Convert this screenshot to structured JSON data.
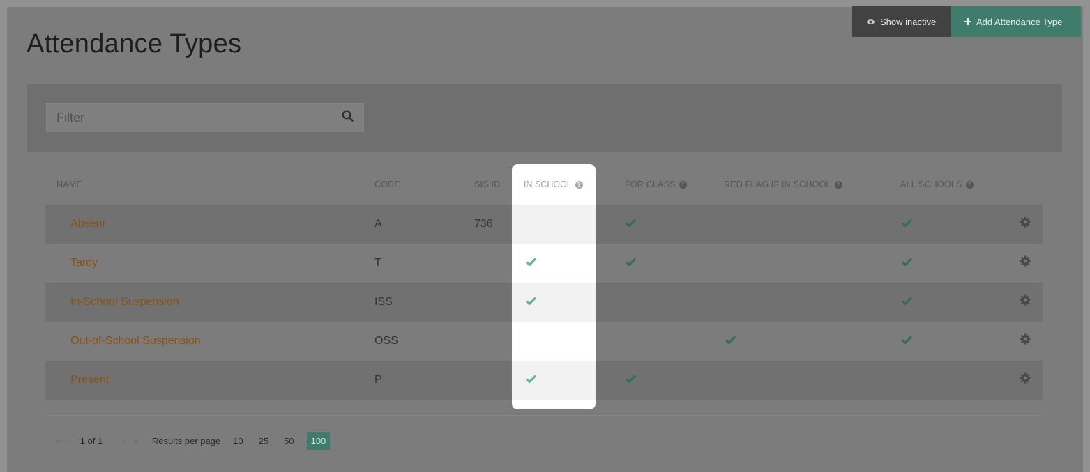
{
  "header": {
    "title": "Attendance Types",
    "show_inactive_label": "Show inactive",
    "add_label": "Add Attendance Type"
  },
  "filter": {
    "placeholder": "Filter"
  },
  "columns": {
    "name": "NAME",
    "code": "CODE",
    "sis_id": "SIS ID",
    "in_school": "IN SCHOOL",
    "for_class": "FOR CLASS",
    "red_flag": "RED FLAG IF IN SCHOOL",
    "all_schools": "ALL SCHOOLS"
  },
  "rows": [
    {
      "name": "Absent",
      "code": "A",
      "sis_id": "736",
      "in_school": false,
      "for_class": true,
      "red_flag": false,
      "all_schools": true
    },
    {
      "name": "Tardy",
      "code": "T",
      "sis_id": "",
      "in_school": true,
      "for_class": true,
      "red_flag": false,
      "all_schools": true
    },
    {
      "name": "In-School Suspension",
      "code": "ISS",
      "sis_id": "",
      "in_school": true,
      "for_class": false,
      "red_flag": false,
      "all_schools": true
    },
    {
      "name": "Out-of-School Suspension",
      "code": "OSS",
      "sis_id": "",
      "in_school": false,
      "for_class": false,
      "red_flag": true,
      "all_schools": true
    },
    {
      "name": "Present",
      "code": "P",
      "sis_id": "",
      "in_school": true,
      "for_class": true,
      "red_flag": false,
      "all_schools": false
    }
  ],
  "pagination": {
    "position": "1 of 1",
    "results_label": "Results per page",
    "options": [
      "10",
      "25",
      "50",
      "100"
    ],
    "selected": "100"
  },
  "colors": {
    "accent": "#57b39a",
    "link": "#d98a2c"
  },
  "icons": {
    "show_inactive": "eye-icon",
    "add": "plus-icon",
    "filter": "search-icon",
    "help": "question-circle-icon",
    "check": "check-icon",
    "row_action": "gear-icon"
  }
}
